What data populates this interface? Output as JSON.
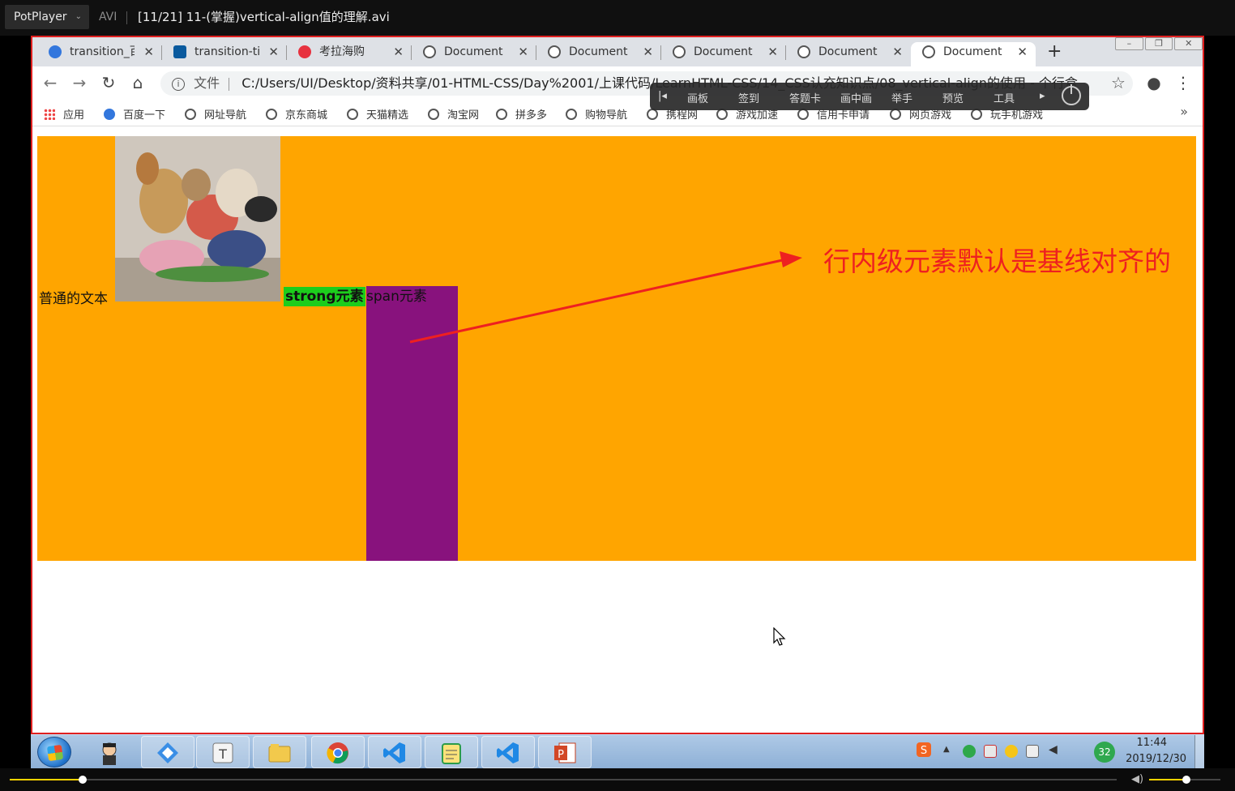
{
  "player": {
    "app_name": "PotPlayer",
    "format": "AVI",
    "file_title": "[11/21] 11-(掌握)vertical-align值的理解.avi",
    "progress_fraction": 0.066,
    "volume_fraction": 0.52
  },
  "browser": {
    "tabs": [
      {
        "label": "transition_百度",
        "icon": "paw-icon"
      },
      {
        "label": "transition-timing",
        "icon": "bird-icon"
      },
      {
        "label": "考拉海购",
        "icon": "kaola-icon"
      },
      {
        "label": "Document",
        "icon": "globe-icon"
      },
      {
        "label": "Document",
        "icon": "globe-icon"
      },
      {
        "label": "Document",
        "icon": "globe-icon"
      },
      {
        "label": "Document",
        "icon": "globe-icon"
      },
      {
        "label": "Document",
        "icon": "globe-icon",
        "active": true
      }
    ],
    "address": {
      "scheme_label": "文件",
      "url": "C:/Users/UI/Desktop/资料共享/01-HTML-CSS/Day%2001/上课代码/LearnHTML-CSS/14_CSS认充知识点/08_vertical-align的使用 - 个行盒"
    },
    "bookmarks": [
      {
        "label": "应用",
        "icon": "apps-icon"
      },
      {
        "label": "百度一下",
        "icon": "paw-icon"
      },
      {
        "label": "网址导航",
        "icon": "globe-icon"
      },
      {
        "label": "京东商城",
        "icon": "globe-icon"
      },
      {
        "label": "天猫精选",
        "icon": "globe-icon"
      },
      {
        "label": "淘宝网",
        "icon": "globe-icon"
      },
      {
        "label": "拼多多",
        "icon": "globe-icon"
      },
      {
        "label": "购物导航",
        "icon": "globe-icon"
      },
      {
        "label": "携程网",
        "icon": "globe-icon"
      },
      {
        "label": "游戏加速",
        "icon": "globe-icon"
      },
      {
        "label": "信用卡申请",
        "icon": "globe-icon"
      },
      {
        "label": "网页游戏",
        "icon": "globe-icon"
      },
      {
        "label": "玩手机游戏",
        "icon": "globe-icon"
      }
    ],
    "bookmarks_more": "»"
  },
  "class_tools": {
    "items": [
      "画板",
      "签到",
      "答题卡",
      "画中画",
      "举手",
      "预览",
      "工具"
    ]
  },
  "page": {
    "plain_text": "普通的文本",
    "strong_text": "strong元素",
    "span_text": "span元素",
    "annotation": "行内级元素默认是基线对齐的",
    "colors": {
      "box": "#ffa500",
      "strong_bg": "#1ccd1c",
      "span_bg": "#88127d",
      "annotation": "#ee2020"
    }
  },
  "taskbar": {
    "tray_badge": "32",
    "time": "11:44",
    "date": "2019/12/30"
  }
}
